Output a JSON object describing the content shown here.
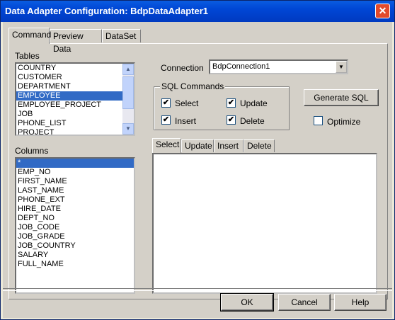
{
  "window": {
    "title": "Data Adapter Configuration: BdpDataAdapter1",
    "close_glyph": "✕"
  },
  "tabs": [
    {
      "label": "Command",
      "active": true
    },
    {
      "label": "Preview Data",
      "active": false
    },
    {
      "label": "DataSet",
      "active": false
    }
  ],
  "tables": {
    "label": "Tables",
    "items": [
      "COUNTRY",
      "CUSTOMER",
      "DEPARTMENT",
      "EMPLOYEE",
      "EMPLOYEE_PROJECT",
      "JOB",
      "PHONE_LIST",
      "PROJECT"
    ],
    "selected": "EMPLOYEE"
  },
  "columns": {
    "label": "Columns",
    "items": [
      "*",
      "EMP_NO",
      "FIRST_NAME",
      "LAST_NAME",
      "PHONE_EXT",
      "HIRE_DATE",
      "DEPT_NO",
      "JOB_CODE",
      "JOB_GRADE",
      "JOB_COUNTRY",
      "SALARY",
      "FULL_NAME"
    ],
    "selected": "*"
  },
  "connection": {
    "label": "Connection",
    "value": "BdpConnection1"
  },
  "sql_commands": {
    "title": "SQL Commands",
    "select": {
      "label": "Select",
      "checked": true
    },
    "update": {
      "label": "Update",
      "checked": true
    },
    "insert": {
      "label": "Insert",
      "checked": true
    },
    "delete": {
      "label": "Delete",
      "checked": true
    }
  },
  "generate_sql_label": "Generate SQL",
  "optimize": {
    "label": "Optimize",
    "checked": false
  },
  "sql_tabs": [
    "Select",
    "Update",
    "Insert",
    "Delete"
  ],
  "sql_text": "",
  "buttons": {
    "ok": "OK",
    "cancel": "Cancel",
    "help": "Help"
  },
  "colors": {
    "selection": "#316ac5",
    "titlebar": "#0046d5",
    "face": "#d4d0c8"
  }
}
